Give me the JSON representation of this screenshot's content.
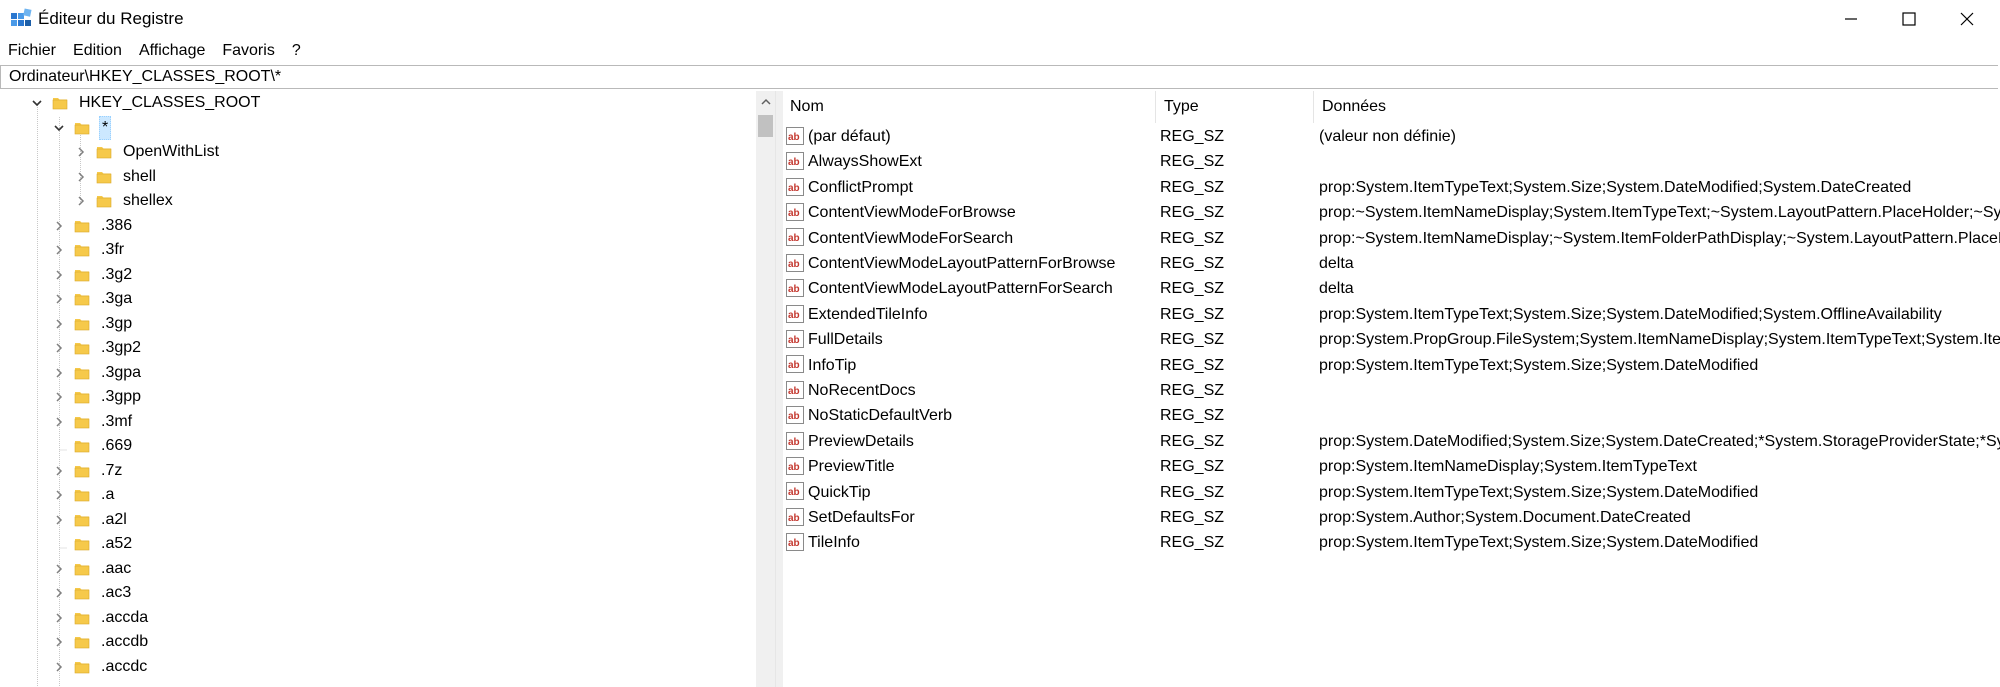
{
  "window": {
    "title": "Éditeur du Registre"
  },
  "menu": [
    "Fichier",
    "Edition",
    "Affichage",
    "Favoris",
    "?"
  ],
  "address": "Ordinateur\\HKEY_CLASSES_ROOT\\*",
  "tree": [
    {
      "label": "HKEY_CLASSES_ROOT",
      "level": 0,
      "expander": "open"
    },
    {
      "label": "*",
      "level": 1,
      "expander": "open",
      "selected": true
    },
    {
      "label": "OpenWithList",
      "level": 2,
      "expander": "closed"
    },
    {
      "label": "shell",
      "level": 2,
      "expander": "closed"
    },
    {
      "label": "shellex",
      "level": 2,
      "expander": "closed"
    },
    {
      "label": ".386",
      "level": 1,
      "expander": "closed"
    },
    {
      "label": ".3fr",
      "level": 1,
      "expander": "closed"
    },
    {
      "label": ".3g2",
      "level": 1,
      "expander": "closed"
    },
    {
      "label": ".3ga",
      "level": 1,
      "expander": "closed"
    },
    {
      "label": ".3gp",
      "level": 1,
      "expander": "closed"
    },
    {
      "label": ".3gp2",
      "level": 1,
      "expander": "closed"
    },
    {
      "label": ".3gpa",
      "level": 1,
      "expander": "closed"
    },
    {
      "label": ".3gpp",
      "level": 1,
      "expander": "closed"
    },
    {
      "label": ".3mf",
      "level": 1,
      "expander": "closed"
    },
    {
      "label": ".669",
      "level": 1,
      "expander": "none"
    },
    {
      "label": ".7z",
      "level": 1,
      "expander": "closed"
    },
    {
      "label": ".a",
      "level": 1,
      "expander": "closed"
    },
    {
      "label": ".a2l",
      "level": 1,
      "expander": "closed"
    },
    {
      "label": ".a52",
      "level": 1,
      "expander": "none"
    },
    {
      "label": ".aac",
      "level": 1,
      "expander": "closed"
    },
    {
      "label": ".ac3",
      "level": 1,
      "expander": "closed"
    },
    {
      "label": ".accda",
      "level": 1,
      "expander": "closed"
    },
    {
      "label": ".accdb",
      "level": 1,
      "expander": "closed"
    },
    {
      "label": ".accdc",
      "level": 1,
      "expander": "closed"
    }
  ],
  "columns": {
    "name": "Nom",
    "type": "Type",
    "data": "Données"
  },
  "values": [
    {
      "name": "(par défaut)",
      "type": "REG_SZ",
      "data": "(valeur non définie)"
    },
    {
      "name": "AlwaysShowExt",
      "type": "REG_SZ",
      "data": ""
    },
    {
      "name": "ConflictPrompt",
      "type": "REG_SZ",
      "data": "prop:System.ItemTypeText;System.Size;System.DateModified;System.DateCreated"
    },
    {
      "name": "ContentViewModeForBrowse",
      "type": "REG_SZ",
      "data": "prop:~System.ItemNameDisplay;System.ItemTypeText;~System.LayoutPattern.PlaceHolder;~System.LayoutPattern.PlaceHolder"
    },
    {
      "name": "ContentViewModeForSearch",
      "type": "REG_SZ",
      "data": "prop:~System.ItemNameDisplay;~System.ItemFolderPathDisplay;~System.LayoutPattern.PlaceHolder"
    },
    {
      "name": "ContentViewModeLayoutPatternForBrowse",
      "type": "REG_SZ",
      "data": "delta"
    },
    {
      "name": "ContentViewModeLayoutPatternForSearch",
      "type": "REG_SZ",
      "data": "delta"
    },
    {
      "name": "ExtendedTileInfo",
      "type": "REG_SZ",
      "data": "prop:System.ItemTypeText;System.Size;System.DateModified;System.OfflineAvailability"
    },
    {
      "name": "FullDetails",
      "type": "REG_SZ",
      "data": "prop:System.PropGroup.FileSystem;System.ItemNameDisplay;System.ItemTypeText;System.ItemFolderPathDisplay"
    },
    {
      "name": "InfoTip",
      "type": "REG_SZ",
      "data": "prop:System.ItemTypeText;System.Size;System.DateModified"
    },
    {
      "name": "NoRecentDocs",
      "type": "REG_SZ",
      "data": ""
    },
    {
      "name": "NoStaticDefaultVerb",
      "type": "REG_SZ",
      "data": ""
    },
    {
      "name": "PreviewDetails",
      "type": "REG_SZ",
      "data": "prop:System.DateModified;System.Size;System.DateCreated;*System.StorageProviderState;*System.SharedWith"
    },
    {
      "name": "PreviewTitle",
      "type": "REG_SZ",
      "data": "prop:System.ItemNameDisplay;System.ItemTypeText"
    },
    {
      "name": "QuickTip",
      "type": "REG_SZ",
      "data": "prop:System.ItemTypeText;System.Size;System.DateModified"
    },
    {
      "name": "SetDefaultsFor",
      "type": "REG_SZ",
      "data": "prop:System.Author;System.Document.DateCreated"
    },
    {
      "name": "TileInfo",
      "type": "REG_SZ",
      "data": "prop:System.ItemTypeText;System.Size;System.DateModified"
    }
  ],
  "colors": {
    "folder": "#f6c94a",
    "selection": "#cce8ff",
    "string_icon_red": "#c4382f"
  },
  "icons": {
    "folder": "folder-icon",
    "string_value": "reg-sz-icon",
    "app": "regedit-icon"
  }
}
